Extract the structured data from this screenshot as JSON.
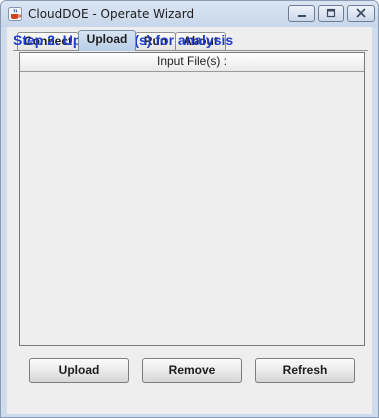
{
  "window": {
    "title": "CloudDOE - Operate Wizard"
  },
  "tabs": [
    {
      "label": "Connect",
      "active": false
    },
    {
      "label": "Upload",
      "active": true
    },
    {
      "label": "Run",
      "active": false
    },
    {
      "label": "About",
      "active": false
    }
  ],
  "step": {
    "title": "Step 2. Upload file(s) for analysis",
    "title_color": "#1f3dcf"
  },
  "table": {
    "column_header": "Input File(s) :",
    "rows": []
  },
  "buttons": {
    "upload": "Upload",
    "remove": "Remove",
    "refresh": "Refresh"
  },
  "icons": {
    "app": "java-cup-icon",
    "minimize": "minimize-icon",
    "maximize": "maximize-icon",
    "close": "close-icon"
  }
}
